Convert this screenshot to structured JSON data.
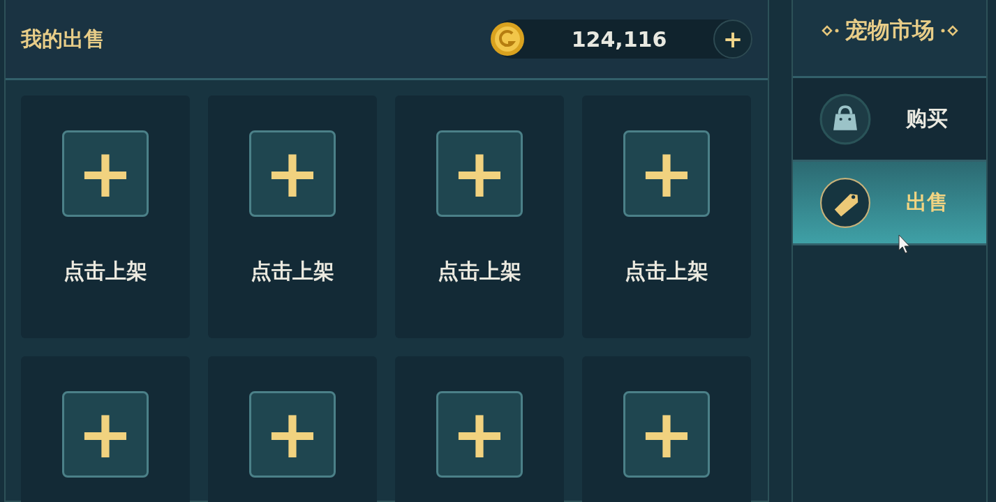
{
  "header": {
    "title": "我的出售",
    "coins": "124,116",
    "add_symbol": "+"
  },
  "slots": [
    {
      "symbol": "+",
      "label": "点击上架"
    },
    {
      "symbol": "+",
      "label": "点击上架"
    },
    {
      "symbol": "+",
      "label": "点击上架"
    },
    {
      "symbol": "+",
      "label": "点击上架"
    },
    {
      "symbol": "+"
    },
    {
      "symbol": "+"
    },
    {
      "symbol": "+"
    },
    {
      "symbol": "+"
    }
  ],
  "sidebar": {
    "title": "宠物市场",
    "tabs": [
      {
        "label": "购买",
        "kind": "bag",
        "selected": false
      },
      {
        "label": "出售",
        "kind": "tag",
        "selected": true
      }
    ]
  }
}
